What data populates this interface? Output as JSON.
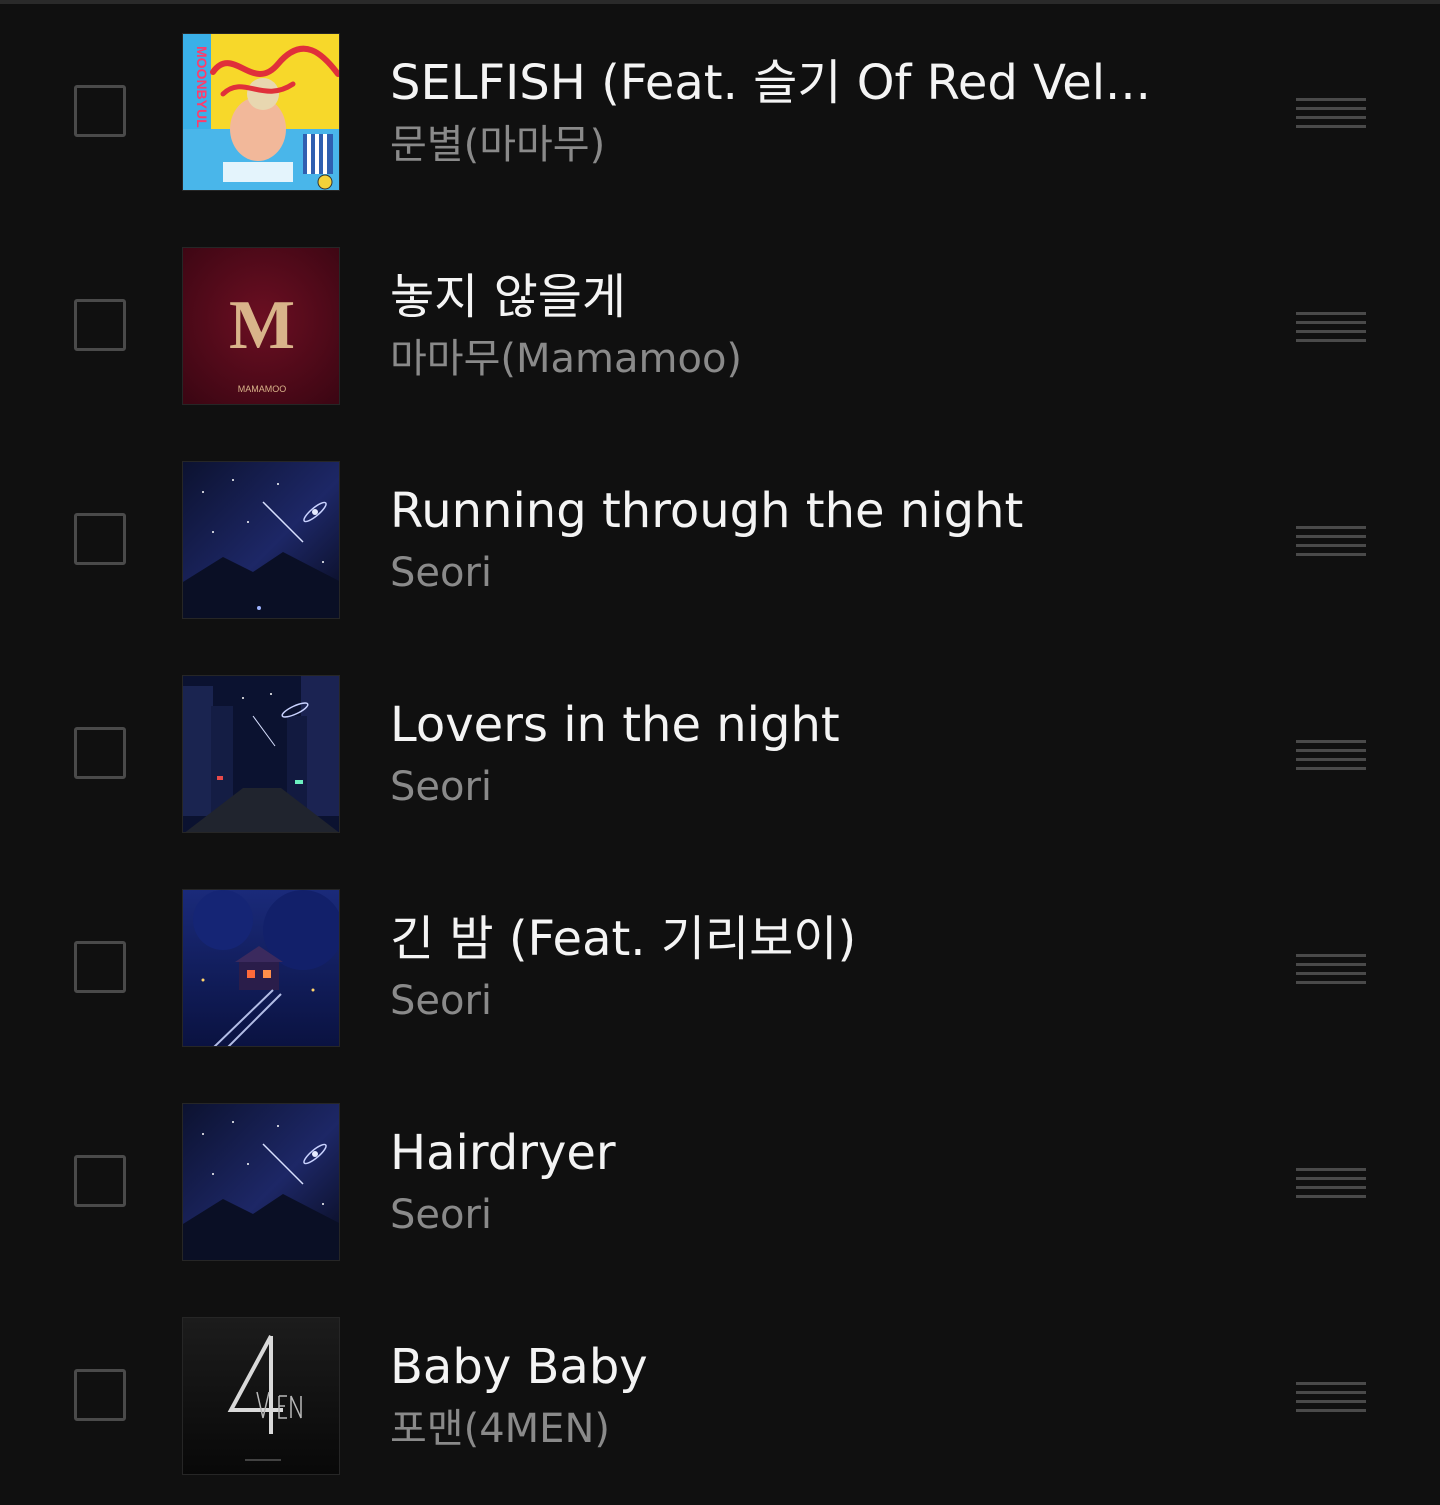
{
  "tracks": [
    {
      "title": "SELFISH (Feat. 슬기 Of Red Vel...",
      "artist": "문별(마마무)",
      "cover_icon": "selfish-album-cover"
    },
    {
      "title": "놓지 않을게",
      "artist": "마마무(Mamamoo)",
      "cover_icon": "mamamoo-album-cover",
      "cover_text": "MAMAMOO"
    },
    {
      "title": "Running through the night",
      "artist": "Seori",
      "cover_icon": "night-sky-album-cover"
    },
    {
      "title": "Lovers in the night",
      "artist": "Seori",
      "cover_icon": "night-city-album-cover"
    },
    {
      "title": "긴 밤 (Feat. 기리보이)",
      "artist": "Seori",
      "cover_icon": "treehouse-night-album-cover"
    },
    {
      "title": "Hairdryer",
      "artist": "Seori",
      "cover_icon": "night-sky-album-cover"
    },
    {
      "title": "Baby Baby",
      "artist": "포맨(4MEN)",
      "cover_icon": "4men-album-cover"
    }
  ],
  "colors": {
    "background": "#101010",
    "title_text": "#f4f4f4",
    "artist_text": "#8a8a8a",
    "control_gray": "#4a4a4a"
  }
}
